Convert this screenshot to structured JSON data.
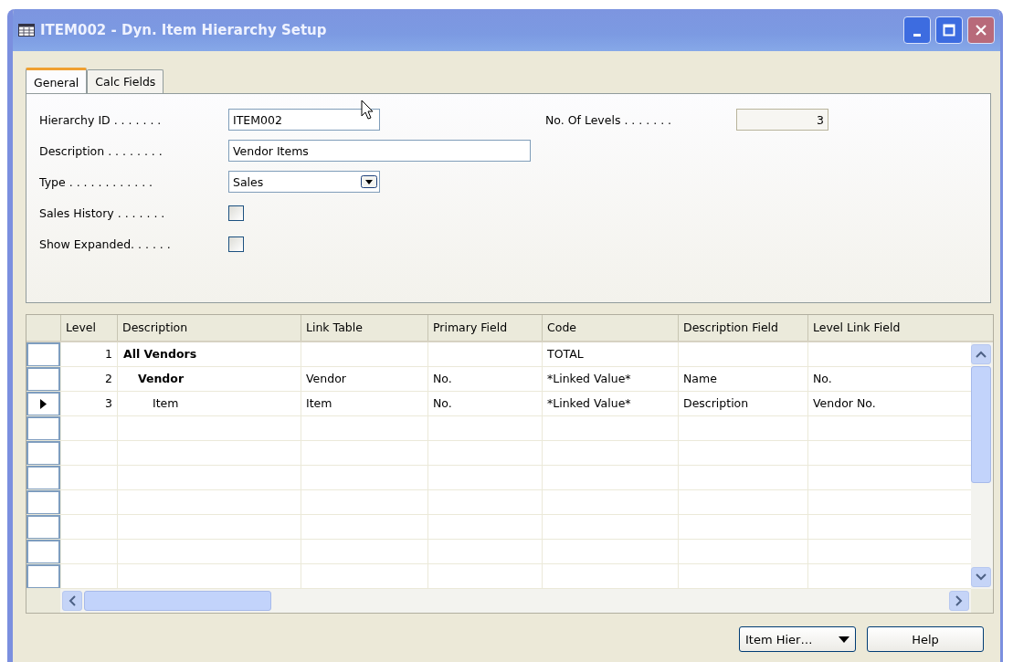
{
  "window": {
    "title": "ITEM002 - Dyn. Item Hierarchy Setup"
  },
  "tabs": [
    {
      "label": "General",
      "selected": true
    },
    {
      "label": "Calc Fields",
      "selected": false
    }
  ],
  "form_left": [
    {
      "kind": "short_text",
      "label": "Hierarchy ID . . . . . . .",
      "value": "ITEM002"
    },
    {
      "kind": "long_text",
      "label": "Description . . . . . . . .",
      "value": "Vendor Items"
    },
    {
      "kind": "dropdown",
      "label": "Type . . . . . . . . . . . .",
      "value": "Sales"
    },
    {
      "kind": "checkbox",
      "label": "Sales History . . . . . . .",
      "checked": false
    },
    {
      "kind": "checkbox",
      "label": "Show Expanded. . . . . .",
      "checked": false
    }
  ],
  "form_right": [
    {
      "kind": "number",
      "label": "No. Of Levels . . . . . . .",
      "value": "3"
    }
  ],
  "table": {
    "columns": [
      "Level",
      "Description",
      "Link Table",
      "Primary Field",
      "Code",
      "Description Field",
      "Level Link Field"
    ],
    "rows": [
      {
        "level": "1",
        "description": "All Vendors",
        "bold": true,
        "code": "TOTAL",
        "selected": false,
        "children": [
          {
            "level": "2",
            "description": "Vendor",
            "bold": true,
            "link_table": "Vendor",
            "primary_field": "No.",
            "code": "*Linked Value*",
            "description_field": "Name",
            "level_link_field": "No.",
            "selected": false,
            "children": [
              {
                "level": "3",
                "description": "Item",
                "bold": false,
                "link_table": "Item",
                "primary_field": "No.",
                "code": "*Linked Value*",
                "description_field": "Description",
                "level_link_field": "Vendor No.",
                "selected": true
              }
            ]
          }
        ]
      }
    ]
  },
  "buttons": [
    {
      "kind": "menu",
      "label": "Item Hier…"
    },
    {
      "kind": "plain",
      "label": "Help"
    }
  ]
}
